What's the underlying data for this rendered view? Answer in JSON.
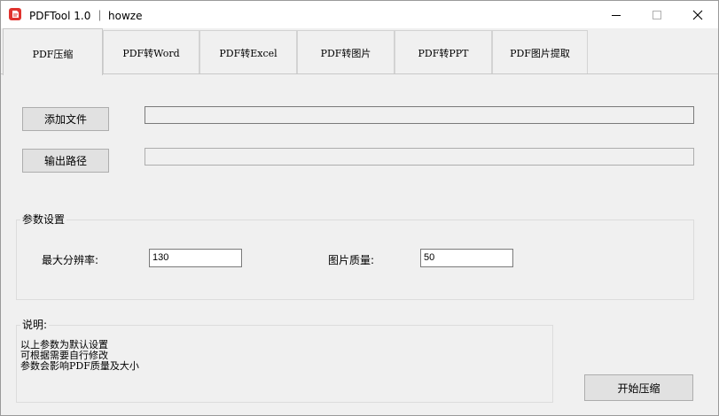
{
  "window": {
    "title": "PDFTool 1.0 ｜ howze",
    "icon": "pdf-app-icon",
    "controls": [
      "minimize-icon",
      "maximize-icon",
      "close-icon"
    ]
  },
  "tabs": [
    {
      "label": "PDF压缩",
      "active": true
    },
    {
      "label": "PDF转Word",
      "active": false
    },
    {
      "label": "PDF转Excel",
      "active": false
    },
    {
      "label": "PDF转图片",
      "active": false
    },
    {
      "label": "PDF转PPT",
      "active": false
    },
    {
      "label": "PDF图片提取",
      "active": false
    }
  ],
  "files": {
    "add_label": "添加文件",
    "add_path": "",
    "output_label": "输出路径",
    "output_path": ""
  },
  "params": {
    "title": "参数设置",
    "max_res_label": "最大分辨率:",
    "max_res_value": "130",
    "quality_label": "图片质量:",
    "quality_value": "50"
  },
  "notes": {
    "title": "说明:",
    "lines": [
      "以上参数为默认设置",
      "可根据需要自行修改",
      "参数会影响PDF质量及大小"
    ]
  },
  "actions": {
    "start_label": "开始压缩"
  },
  "colors": {
    "app_icon": "#e0332e",
    "button_bg": "#e1e1e1",
    "window_bg": "#f0f0f0"
  }
}
